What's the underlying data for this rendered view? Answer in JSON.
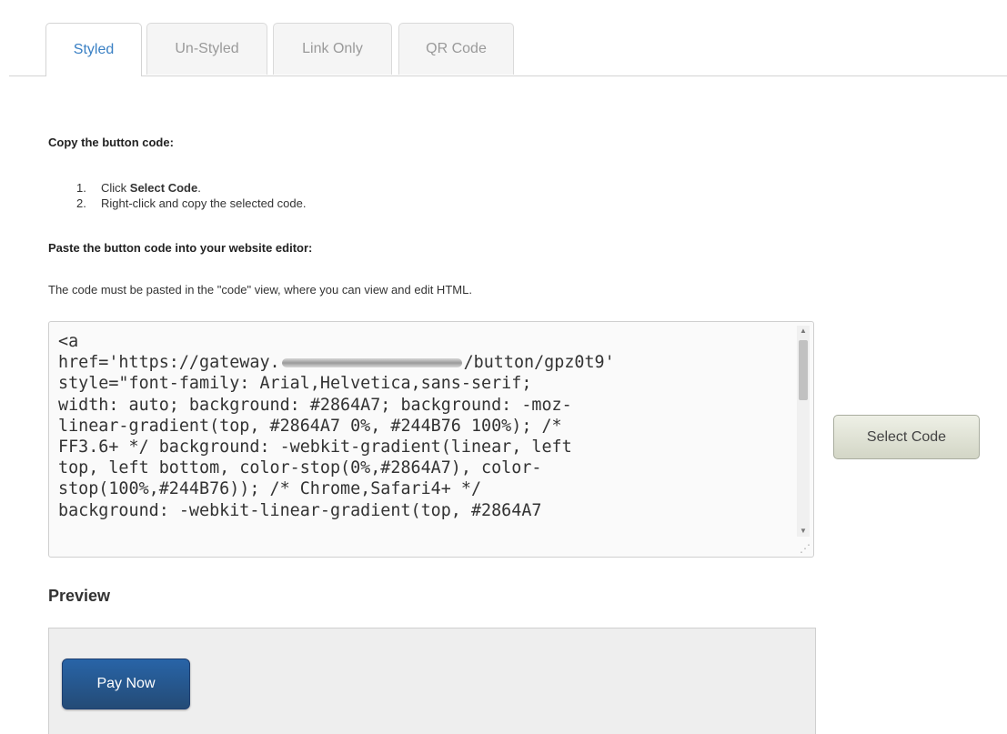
{
  "tabs": [
    {
      "label": "Styled",
      "active": true
    },
    {
      "label": "Un-Styled",
      "active": false
    },
    {
      "label": "Link Only",
      "active": false
    },
    {
      "label": "QR Code",
      "active": false
    }
  ],
  "instructions": {
    "copy_title": "Copy the button code:",
    "steps": [
      {
        "num": "1.",
        "prefix": "Click ",
        "bold": "Select Code",
        "suffix": "."
      },
      {
        "num": "2.",
        "text": "Right-click and copy the selected code."
      }
    ],
    "paste_title": "Paste the button code into your website editor:",
    "paragraph": "The code must be pasted in the \"code\" view, where you can view and edit HTML."
  },
  "code": {
    "lines": [
      "<a",
      "href='https://gateway.",
      "/button/gpz0t9'",
      "style=\"font-family: Arial,Helvetica,sans-serif;",
      "width: auto; background: #2864A7; background: -moz-",
      "linear-gradient(top, #2864A7 0%, #244B76 100%); /*",
      "FF3.6+ */ background: -webkit-gradient(linear, left",
      "top, left bottom, color-stop(0%,#2864A7), color-",
      "stop(100%,#244B76)); /* Chrome,Safari4+ */",
      "background: -webkit-linear-gradient(top, #2864A7"
    ]
  },
  "select_button": {
    "label": "Select Code"
  },
  "preview": {
    "title": "Preview",
    "pay_button_label": "Pay Now"
  },
  "colors": {
    "active_tab_text": "#3a80c4",
    "pay_button_top": "#2864A7",
    "pay_button_bottom": "#244B76"
  },
  "icons": {
    "scroll_up": "scroll-up-arrow-icon",
    "scroll_down": "scroll-down-arrow-icon",
    "resize": "resize-grip-icon"
  }
}
